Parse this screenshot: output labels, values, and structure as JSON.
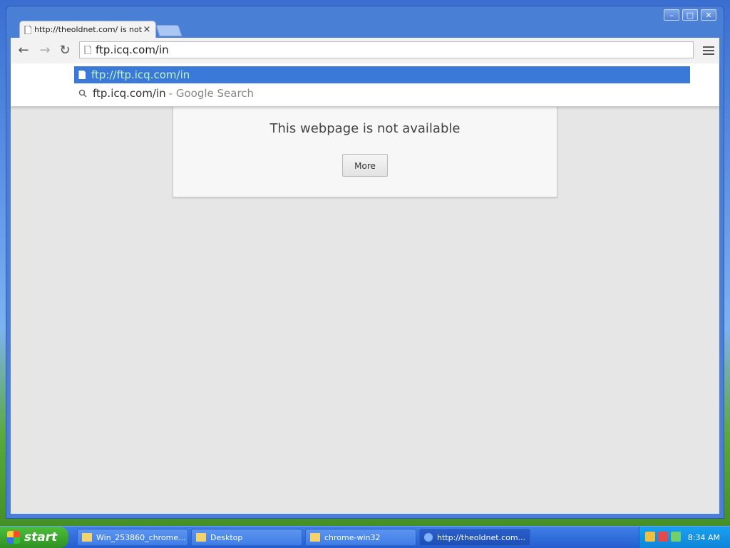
{
  "browser": {
    "tab": {
      "title": "http://theoldnet.com/ is not"
    },
    "window_controls": {
      "minimize": "–",
      "maximize": "□",
      "close": "✕"
    },
    "toolbar": {
      "back_icon": "←",
      "forward_icon": "→",
      "reload_icon": "↻",
      "omnibox_value": "ftp.icq.com/in"
    },
    "autocomplete": [
      {
        "text": "ftp://ftp.icq.com/in",
        "icon": "page-icon",
        "selected": true
      },
      {
        "text": "ftp.icq.com/in",
        "suffix": "- Google Search",
        "icon": "search-icon",
        "selected": false
      }
    ],
    "page": {
      "error_title": "This webpage is not available",
      "more_button": "More"
    }
  },
  "taskbar": {
    "start_label": "start",
    "tasks": [
      {
        "label": "Win_253860_chrome..."
      },
      {
        "label": "Desktop"
      },
      {
        "label": "chrome-win32"
      },
      {
        "label": "http://theoldnet.com..."
      }
    ],
    "clock": "8:34 AM"
  },
  "colors": {
    "xp_blue": "#245dd0",
    "selection_blue": "#3a79d8",
    "start_green": "#2f9122"
  }
}
